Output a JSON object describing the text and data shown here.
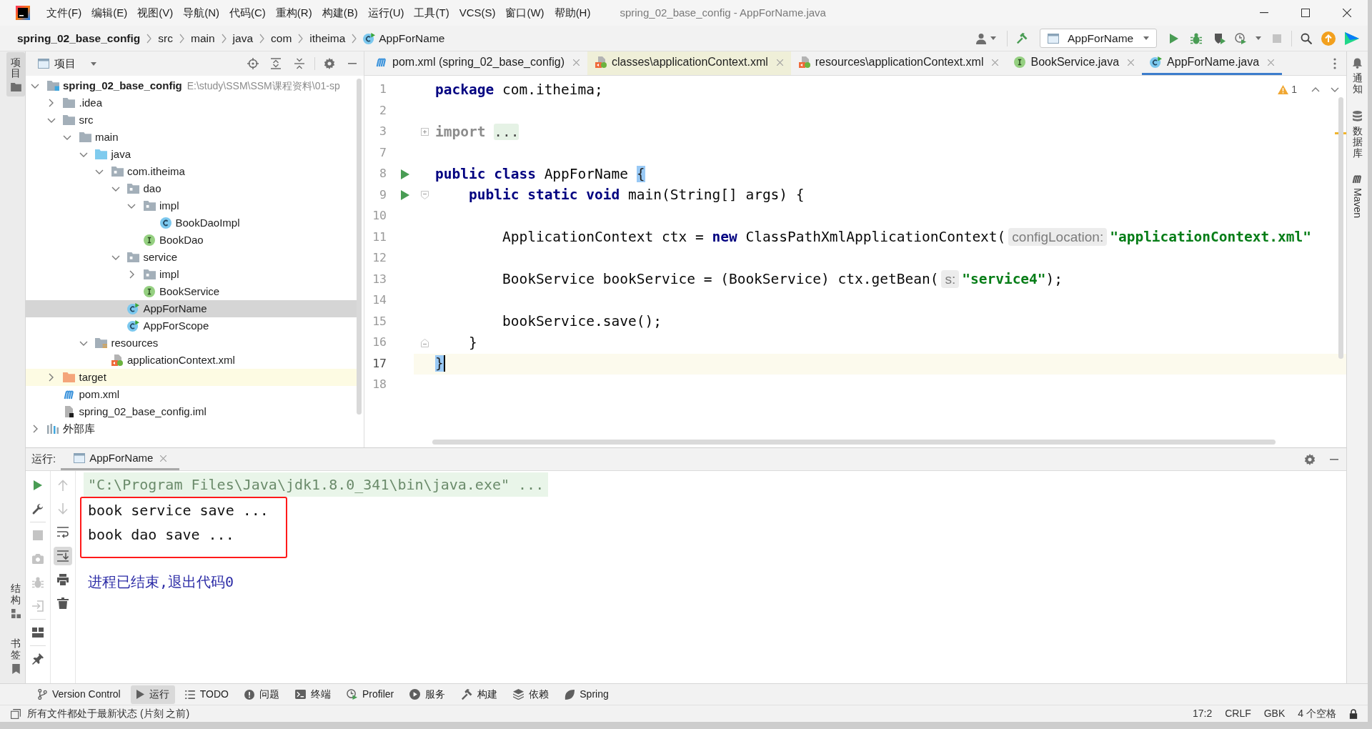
{
  "title_bar": {
    "menu": [
      "文件(F)",
      "编辑(E)",
      "视图(V)",
      "导航(N)",
      "代码(C)",
      "重构(R)",
      "构建(B)",
      "运行(U)",
      "工具(T)",
      "VCS(S)",
      "窗口(W)",
      "帮助(H)"
    ],
    "title": "spring_02_base_config - AppForName.java"
  },
  "navigation_bar": {
    "breadcrumbs": [
      {
        "label": "spring_02_base_config",
        "kind": "project"
      },
      {
        "label": "src",
        "kind": "folder"
      },
      {
        "label": "main",
        "kind": "folder"
      },
      {
        "label": "java",
        "kind": "folder"
      },
      {
        "label": "com",
        "kind": "folder"
      },
      {
        "label": "itheima",
        "kind": "folder"
      },
      {
        "label": "AppForName",
        "kind": "runnable-class"
      }
    ],
    "run_configuration": "AppForName",
    "stop_enabled": false
  },
  "left_strip": {
    "top": [
      {
        "label": "项目",
        "selected": true
      }
    ],
    "bottom": [
      {
        "label": "结构",
        "selected": false
      },
      {
        "label": "书签",
        "selected": false
      }
    ]
  },
  "project_panel": {
    "title": "项目",
    "tree": [
      {
        "label": "spring_02_base_config",
        "path": "E:\\study\\SSM\\SSM课程资料\\01-sp",
        "kind": "module",
        "expanded": true,
        "selected": false,
        "highlighted": false,
        "children": [
          {
            "label": ".idea",
            "kind": "folder",
            "expanded": false,
            "selected": false,
            "highlighted": false
          },
          {
            "label": "src",
            "kind": "folder",
            "expanded": true,
            "selected": false,
            "highlighted": false,
            "children": [
              {
                "label": "main",
                "kind": "folder",
                "expanded": true,
                "selected": false,
                "highlighted": false,
                "children": [
                  {
                    "label": "java",
                    "kind": "source-root",
                    "expanded": true,
                    "selected": false,
                    "highlighted": false,
                    "children": [
                      {
                        "label": "com.itheima",
                        "kind": "package",
                        "expanded": true,
                        "selected": false,
                        "highlighted": false,
                        "children": [
                          {
                            "label": "dao",
                            "kind": "package",
                            "expanded": true,
                            "selected": false,
                            "highlighted": false,
                            "children": [
                              {
                                "label": "impl",
                                "kind": "package",
                                "expanded": true,
                                "selected": false,
                                "highlighted": false,
                                "children": [
                                  {
                                    "label": "BookDaoImpl",
                                    "kind": "class",
                                    "selected": false,
                                    "highlighted": false
                                  }
                                ]
                              },
                              {
                                "label": "BookDao",
                                "kind": "interface",
                                "selected": false,
                                "highlighted": false
                              }
                            ]
                          },
                          {
                            "label": "service",
                            "kind": "package",
                            "expanded": true,
                            "selected": false,
                            "highlighted": false,
                            "children": [
                              {
                                "label": "impl",
                                "kind": "package",
                                "expanded": false,
                                "selected": false,
                                "highlighted": false
                              },
                              {
                                "label": "BookService",
                                "kind": "interface",
                                "selected": false,
                                "highlighted": false
                              }
                            ]
                          },
                          {
                            "label": "AppForName",
                            "kind": "runnable-class",
                            "selected": true,
                            "highlighted": false
                          },
                          {
                            "label": "AppForScope",
                            "kind": "runnable-class",
                            "selected": false,
                            "highlighted": false
                          }
                        ]
                      }
                    ]
                  },
                  {
                    "label": "resources",
                    "kind": "resources-root",
                    "expanded": true,
                    "selected": false,
                    "highlighted": false,
                    "children": [
                      {
                        "label": "applicationContext.xml",
                        "kind": "spring-xml",
                        "selected": false,
                        "highlighted": false
                      }
                    ]
                  }
                ]
              }
            ]
          },
          {
            "label": "target",
            "kind": "excluded-folder",
            "expanded": false,
            "selected": false,
            "highlighted": true
          },
          {
            "label": "pom.xml",
            "kind": "maven",
            "selected": false,
            "highlighted": false
          },
          {
            "label": "spring_02_base_config.iml",
            "kind": "iml",
            "selected": false,
            "highlighted": false
          }
        ]
      },
      {
        "label": "外部库",
        "kind": "library",
        "expanded": false,
        "selected": false,
        "highlighted": false
      }
    ]
  },
  "editor": {
    "tabs": [
      {
        "label": "pom.xml (spring_02_base_config)",
        "kind": "maven",
        "selected": false,
        "highlighted": false
      },
      {
        "label": "classes\\applicationContext.xml",
        "kind": "spring-xml",
        "selected": false,
        "highlighted": true
      },
      {
        "label": "resources\\applicationContext.xml",
        "kind": "spring-xml",
        "selected": false,
        "highlighted": false
      },
      {
        "label": "BookService.java",
        "kind": "interface",
        "selected": false,
        "highlighted": false
      },
      {
        "label": "AppForName.java",
        "kind": "runnable-class",
        "selected": true,
        "highlighted": false
      }
    ],
    "problem_count": "1",
    "lines": [
      {
        "number": "1",
        "run": false,
        "current": false,
        "tokens": [
          {
            "kind": "keyword",
            "text": "package"
          },
          {
            "kind": "plain",
            "text": " com.itheima;"
          }
        ]
      },
      {
        "number": "2",
        "run": false,
        "current": false
      },
      {
        "number": "3",
        "run": false,
        "current": false,
        "fold": {
          "kind": "collapsed"
        },
        "tokens": [
          {
            "kind": "muted",
            "text": "import "
          },
          {
            "kind": "folded",
            "text": "..."
          }
        ]
      },
      {
        "number": "7",
        "run": false,
        "current": false
      },
      {
        "number": "8",
        "run": true,
        "current": false,
        "tokens": [
          {
            "kind": "keyword",
            "text": "public class"
          },
          {
            "kind": "plain",
            "text": " AppForName "
          },
          {
            "kind": "brace-match",
            "text": "{"
          }
        ]
      },
      {
        "number": "9",
        "run": true,
        "current": false,
        "fold": {
          "kind": "start"
        },
        "tokens": [
          {
            "kind": "keyword",
            "text": "    public static void"
          },
          {
            "kind": "plain",
            "text": " main(String[] args) {"
          }
        ]
      },
      {
        "number": "10",
        "run": false,
        "current": false
      },
      {
        "number": "11",
        "run": false,
        "current": false,
        "tokens": [
          {
            "kind": "plain",
            "text": "        ApplicationContext ctx = "
          },
          {
            "kind": "keyword",
            "text": "new"
          },
          {
            "kind": "plain",
            "text": " ClassPathXmlApplicationContext("
          },
          {
            "kind": "hint",
            "text": "configLocation:"
          },
          {
            "kind": "string",
            "text": "\"applicationContext.xml\""
          }
        ]
      },
      {
        "number": "12",
        "run": false,
        "current": false
      },
      {
        "number": "13",
        "run": false,
        "current": false,
        "tokens": [
          {
            "kind": "plain",
            "text": "        BookService bookService = (BookService) ctx.getBean("
          },
          {
            "kind": "hint",
            "text": "s:"
          },
          {
            "kind": "string",
            "text": "\"service4\""
          },
          {
            "kind": "plain",
            "text": ");"
          }
        ]
      },
      {
        "number": "14",
        "run": false,
        "current": false
      },
      {
        "number": "15",
        "run": false,
        "current": false,
        "tokens": [
          {
            "kind": "plain",
            "text": "        bookService.save();"
          }
        ]
      },
      {
        "number": "16",
        "run": false,
        "current": false,
        "fold": {
          "kind": "end"
        },
        "tokens": [
          {
            "kind": "plain",
            "text": "    }"
          }
        ]
      },
      {
        "number": "17",
        "run": false,
        "current": true,
        "tokens": [
          {
            "kind": "brace-match",
            "text": "}"
          }
        ]
      },
      {
        "number": "18",
        "run": false,
        "current": false
      }
    ]
  },
  "right_strip": [
    {
      "label": "通知"
    },
    {
      "label": "数据库"
    },
    {
      "label": "Maven"
    }
  ],
  "run_panel": {
    "label": "运行:",
    "tabs": [
      {
        "label": "AppForName",
        "selected": true
      }
    ],
    "toolbar": [
      [
        {
          "disabled": false,
          "on": false
        },
        {
          "disabled": false,
          "on": false
        },
        {
          "disabled": true,
          "on": false
        },
        {
          "disabled": true,
          "on": false
        },
        {
          "disabled": true,
          "on": false
        },
        {
          "disabled": true,
          "on": false
        },
        {
          "disabled": false,
          "on": false
        },
        {
          "disabled": false,
          "on": false
        }
      ],
      [
        {
          "disabled": true,
          "on": false
        },
        {
          "disabled": true,
          "on": false
        },
        {
          "disabled": false,
          "on": false
        },
        {
          "disabled": false,
          "on": true
        },
        {
          "disabled": false,
          "on": false
        },
        {
          "disabled": false,
          "on": false
        }
      ]
    ],
    "console": [
      {
        "kind": "command",
        "text": "\"C:\\Program Files\\Java\\jdk1.8.0_341\\bin\\java.exe\" ...",
        "boxed": false
      },
      {
        "kind": "output",
        "text": "book service save ...",
        "boxed": true
      },
      {
        "kind": "output",
        "text": "book dao save ...",
        "boxed": true
      },
      {
        "kind": "exit",
        "text": "进程已结束,退出代码0",
        "boxed": false
      }
    ]
  },
  "tool_window_bar": [
    {
      "label": "Version Control",
      "selected": false
    },
    {
      "label": "运行",
      "selected": true
    },
    {
      "label": "TODO",
      "selected": false
    },
    {
      "label": "问题",
      "selected": false
    },
    {
      "label": "终端",
      "selected": false
    },
    {
      "label": "Profiler",
      "selected": false
    },
    {
      "label": "服务",
      "selected": false
    },
    {
      "label": "构建",
      "selected": false
    },
    {
      "label": "依赖",
      "selected": false
    },
    {
      "label": "Spring",
      "selected": false
    }
  ],
  "status_bar": {
    "message": "所有文件都处于最新状态 (片刻 之前)",
    "items": [
      "17:2",
      "CRLF",
      "GBK",
      "4 个空格"
    ]
  }
}
